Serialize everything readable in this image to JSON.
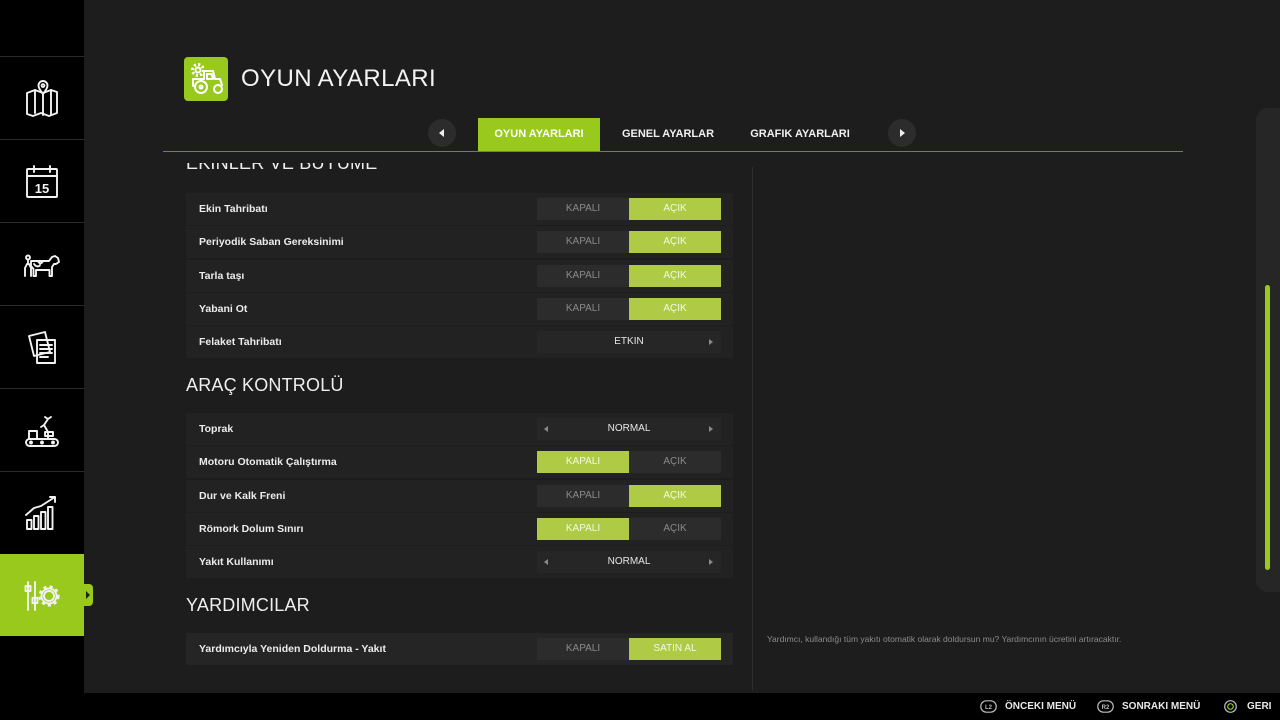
{
  "colors": {
    "accent": "#98c91c",
    "toggle_on": "#afcb46",
    "background": "#1d1d1d",
    "sidebar": "#000000",
    "row": "#222222"
  },
  "sidebar": {
    "items": [
      {
        "icon": "map-icon",
        "selected": false
      },
      {
        "icon": "calendar-icon",
        "day": "15",
        "selected": false
      },
      {
        "icon": "animals-icon",
        "selected": false
      },
      {
        "icon": "contracts-icon",
        "selected": false
      },
      {
        "icon": "production-icon",
        "selected": false
      },
      {
        "icon": "statistics-icon",
        "selected": false
      },
      {
        "icon": "settings-icon",
        "selected": true
      }
    ]
  },
  "header": {
    "icon": "tractor-settings-icon",
    "title": "OYUN AYARLARI"
  },
  "tabs": {
    "prev_icon": "arrow-left-icon",
    "next_icon": "arrow-right-icon",
    "items": [
      {
        "label": "OYUN AYARLARI",
        "selected": true
      },
      {
        "label": "GENEL AYARLAR",
        "selected": false
      },
      {
        "label": "GRAFIK AYARLARI",
        "selected": false
      }
    ]
  },
  "sections": [
    {
      "title": "EKINLER VE BÜYÜME",
      "rows": [
        {
          "label": "Ekin Tahribatı",
          "options": [
            "KAPALI",
            "AÇIK"
          ],
          "selected": 1
        },
        {
          "label": "Periyodik Saban Gereksinimi",
          "options": [
            "KAPALI",
            "AÇIK"
          ],
          "selected": 1
        },
        {
          "label": "Tarla taşı",
          "options": [
            "KAPALI",
            "AÇIK"
          ],
          "selected": 1
        },
        {
          "label": "Yabani Ot",
          "options": [
            "KAPALI",
            "AÇIK"
          ],
          "selected": 1
        },
        {
          "label": "Felaket Tahribatı",
          "value": "ETKIN",
          "has_prev": false,
          "has_next": true
        }
      ]
    },
    {
      "title": "ARAÇ KONTROLÜ",
      "rows": [
        {
          "label": "Toprak",
          "value": "NORMAL",
          "has_prev": true,
          "has_next": true
        },
        {
          "label": "Motoru Otomatik Çalıştırma",
          "options": [
            "KAPALI",
            "AÇIK"
          ],
          "selected": 0
        },
        {
          "label": "Dur ve Kalk Freni",
          "options": [
            "KAPALI",
            "AÇIK"
          ],
          "selected": 1
        },
        {
          "label": "Römork Dolum Sınırı",
          "options": [
            "KAPALI",
            "AÇIK"
          ],
          "selected": 0
        },
        {
          "label": "Yakıt Kullanımı",
          "value": "NORMAL",
          "has_prev": true,
          "has_next": true
        }
      ]
    },
    {
      "title": "YARDIMCILAR",
      "rows": [
        {
          "label": "Yardımcıyla Yeniden Doldurma - Yakıt",
          "options": [
            "KAPALI",
            "SATIN AL"
          ],
          "selected": 1,
          "focused": true
        }
      ]
    }
  ],
  "help_text": "Yardımcı, kullandığı tüm yakıtı otomatik olarak doldursun mu? Yardımcının ücretini artıracaktır.",
  "scrollbar": {
    "position_percent": 89
  },
  "footer": {
    "buttons": [
      {
        "icon": "l2-button-icon",
        "glyph": "L2",
        "label": "ÖNCEKI MENÜ"
      },
      {
        "icon": "r2-button-icon",
        "glyph": "R2",
        "label": "SONRAKI MENÜ"
      },
      {
        "icon": "circle-button-icon",
        "label": "GERI"
      }
    ]
  }
}
